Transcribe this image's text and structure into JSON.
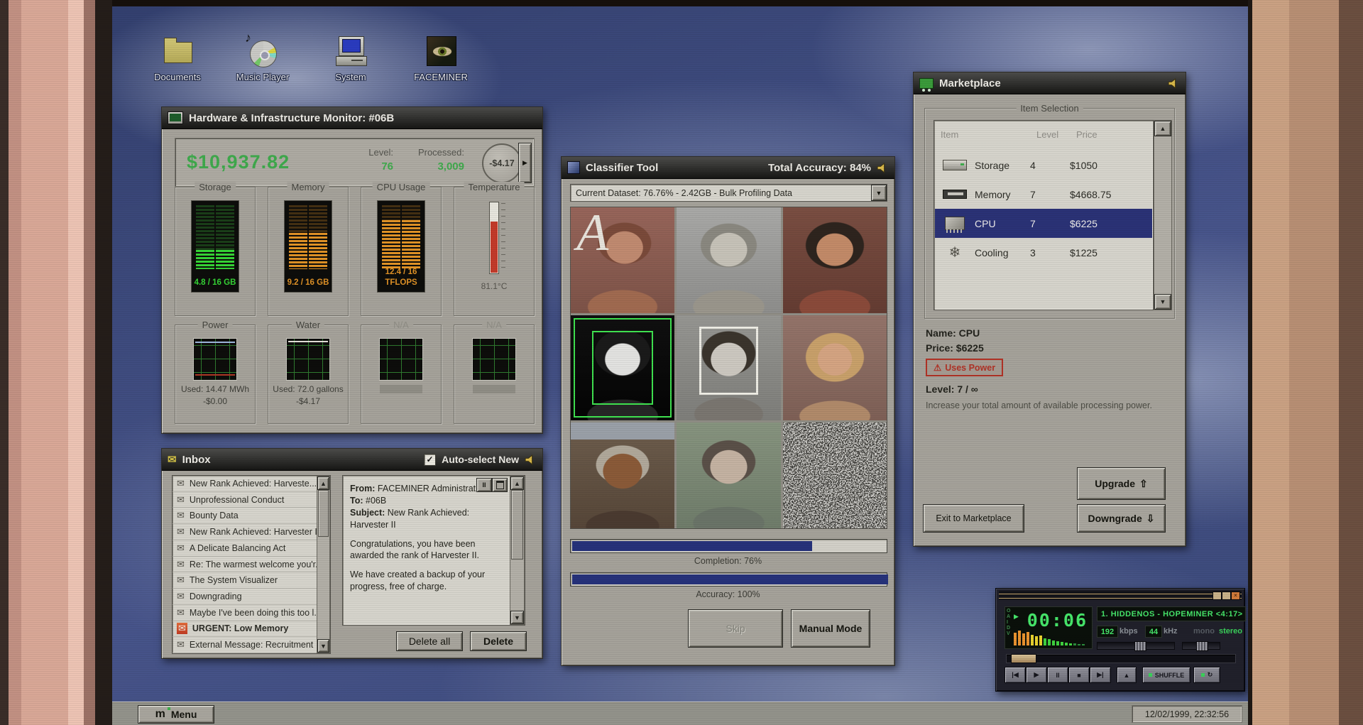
{
  "colors": {
    "money_green": "#3fa94c",
    "led_green": "#35d435",
    "led_orange": "#e09226",
    "selection_navy": "#2a3276",
    "progress_navy": "#26327a",
    "warning_red": "#b03226",
    "lcd_green": "#46e56a"
  },
  "desktop": {
    "icons": [
      {
        "label": "Documents"
      },
      {
        "label": "Music Player"
      },
      {
        "label": "System"
      },
      {
        "label": "FACEMINER"
      }
    ]
  },
  "hardware_monitor": {
    "title": "Hardware & Infrastructure Monitor: #06B",
    "balance": "$10,937.82",
    "level_label": "Level:",
    "level_value": "76",
    "processed_label": "Processed:",
    "processed_value": "3,009",
    "rate": "-$4.17",
    "tick_arrow": "▶",
    "gauges": [
      {
        "label": "Storage",
        "value": "4.8 / 16 GB",
        "fill_pct": 30
      },
      {
        "label": "Memory",
        "value": "9.2 / 16 GB",
        "fill_pct": 57
      },
      {
        "label": "CPU Usage",
        "value": "12.4 / 16 TFLOPS",
        "fill_pct": 77
      },
      {
        "label": "Temperature",
        "value": "81.1°C",
        "fill_pct": 72
      }
    ],
    "meters": [
      {
        "label": "Power",
        "used": "Used: 14.47 MWh",
        "cost": "-$0.00"
      },
      {
        "label": "Water",
        "used": "Used: 72.0 gallons",
        "cost": "-$4.17"
      },
      {
        "label": "N/A"
      },
      {
        "label": "N/A"
      }
    ]
  },
  "inbox": {
    "title": "Inbox",
    "autoselect_label": "Auto-select New",
    "checkmark": "✓",
    "messages": [
      "New Rank Achieved: Harveste...",
      "Unprofessional Conduct",
      "Bounty Data",
      "New Rank Achieved: Harvester I",
      "A Delicate Balancing Act",
      "Re: The warmest welcome you'r...",
      "The System Visualizer",
      "Downgrading",
      "Maybe I've been doing this too l...",
      "URGENT: Low Memory",
      "External Message: Recruitment"
    ],
    "preview": {
      "from_label": "From:",
      "from": "FACEMINER Administration",
      "to_label": "To:",
      "to": "#06B",
      "subject_label": "Subject:",
      "subject": "New Rank Achieved: Harvester II",
      "body_1": "Congratulations, you have been awarded the rank of Harvester II.",
      "body_2": "We have created a backup of your progress, free of charge."
    },
    "pause_glyph": "II",
    "delete_all_label": "Delete all",
    "delete_label": "Delete"
  },
  "classifier": {
    "title": "Classifier Tool",
    "total_accuracy": "Total Accuracy: 84%",
    "dataset": "Current Dataset: 76.76% - 2.42GB - Bulk Profiling Data",
    "watermark": "A",
    "completion_label": "Completion: 76%",
    "completion_pct": 76,
    "accuracy_label": "Accuracy: 100%",
    "accuracy_pct": 100,
    "skip_label": "Skip",
    "manual_label": "Manual Mode"
  },
  "marketplace": {
    "title": "Marketplace",
    "selection_label": "Item Selection",
    "columns": {
      "item": "Item",
      "level": "Level",
      "price": "Price"
    },
    "items": [
      {
        "name": "Storage",
        "level": "4",
        "price": "$1050"
      },
      {
        "name": "Memory",
        "level": "7",
        "price": "$4668.75"
      },
      {
        "name": "CPU",
        "level": "7",
        "price": "$6225"
      },
      {
        "name": "Cooling",
        "level": "3",
        "price": "$1225"
      }
    ],
    "detail": {
      "name_line": "Name: CPU",
      "price_line": "Price: $6225",
      "warning_icon": "⚠",
      "warning": "Uses Power",
      "level_line": "Level: 7 / ∞",
      "description": "Increase your total amount of available processing power."
    },
    "upgrade_label": "Upgrade",
    "upgrade_arrow": "⇧",
    "downgrade_label": "Downgrade",
    "downgrade_arrow": "⇩",
    "exit_label": "Exit to Marketplace"
  },
  "player": {
    "time": "00:06",
    "play_glyph": "▶",
    "track": "1. HIDDENOS - HOPEMINER <4:17>",
    "bitrate": "192",
    "bitrate_unit": "kbps",
    "samplerate": "44",
    "samplerate_unit": "kHz",
    "mono_label": "mono",
    "stereo_label": "stereo",
    "clutter": [
      "O",
      "A",
      "I",
      "D",
      "V"
    ],
    "controls": {
      "previous": "|◀",
      "play": "▶",
      "pause": "II",
      "stop": "■",
      "next": "▶|",
      "eject": "▲"
    },
    "shuffle_label": "SHUFFLE",
    "repeat_glyph": "↻",
    "close_glyph": "×"
  },
  "taskbar": {
    "menu_logo": "m",
    "menu_label": "Menu",
    "clock": "12/02/1999, 22:32:56"
  }
}
